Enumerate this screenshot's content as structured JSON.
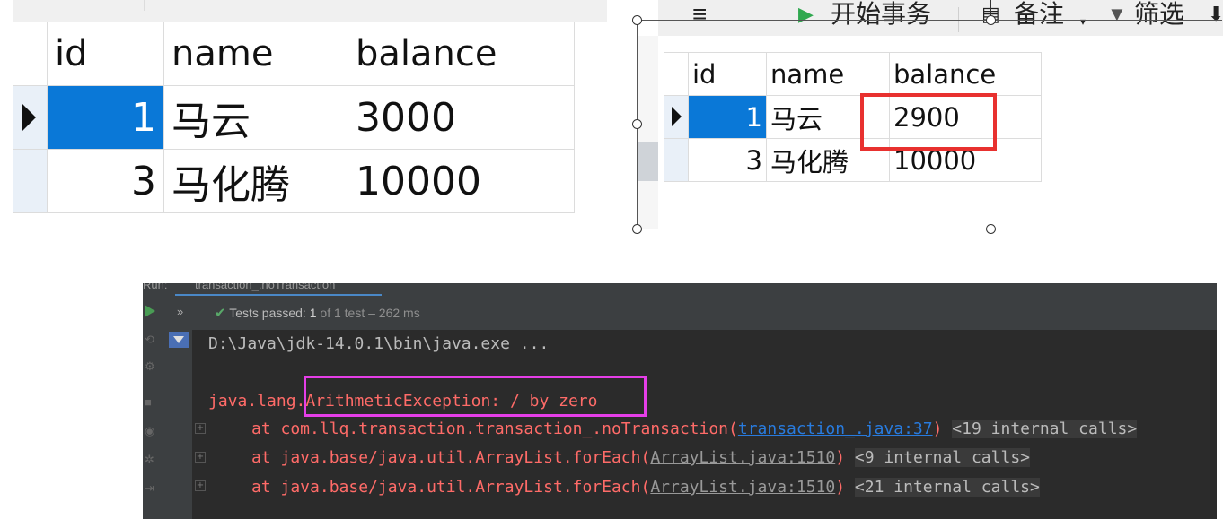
{
  "grid_before": {
    "columns": [
      "id",
      "name",
      "balance"
    ],
    "rows": [
      {
        "id": "1",
        "name": "马云",
        "balance": "3000",
        "current": true
      },
      {
        "id": "3",
        "name": "马化腾",
        "balance": "10000",
        "current": false
      }
    ]
  },
  "grid_after": {
    "toolbar": {
      "menu_icon": "≡",
      "begin_transaction_icon": "▶",
      "begin_transaction": "开始事务",
      "note_icon": "note-icon",
      "note": "备注",
      "filter_icon": "filter-icon",
      "filter": "筛选"
    },
    "columns": [
      "id",
      "name",
      "balance"
    ],
    "rows": [
      {
        "id": "1",
        "name": "马云",
        "balance": "2900",
        "current": true
      },
      {
        "id": "3",
        "name": "马化腾",
        "balance": "10000",
        "current": false
      }
    ],
    "highlight_color": "#e8312f"
  },
  "console": {
    "tab_prefix": "Run:",
    "tab_label": "transaction_.noTransaction",
    "status_check": "✔",
    "status_passed": "Tests passed:",
    "status_count": "1",
    "status_detail": "of 1 test – 262 ms",
    "command": "D:\\Java\\jdk-14.0.1\\bin\\java.exe ...",
    "exception_prefix": "java.lang.",
    "exception_main": "ArithmeticException: / by zero",
    "stack": [
      {
        "prefix": "at com.llq.transaction.transaction_.noTransaction(",
        "link": "transaction_.java:37",
        "suffix": ")",
        "internal": "<19 internal calls>"
      },
      {
        "prefix": "at java.base/java.util.ArrayList.forEach(",
        "link": "ArrayList.java:1510",
        "suffix": ")",
        "internal": "<9 internal calls>"
      },
      {
        "prefix": "at java.base/java.util.ArrayList.forEach(",
        "link": "ArrayList.java:1510",
        "suffix": ")",
        "internal": "<21 internal calls>"
      }
    ],
    "highlight_color": "#e53ee8",
    "colors": {
      "background": "#2b2b2b",
      "error": "#ff6b68",
      "link": "#287bde"
    }
  }
}
